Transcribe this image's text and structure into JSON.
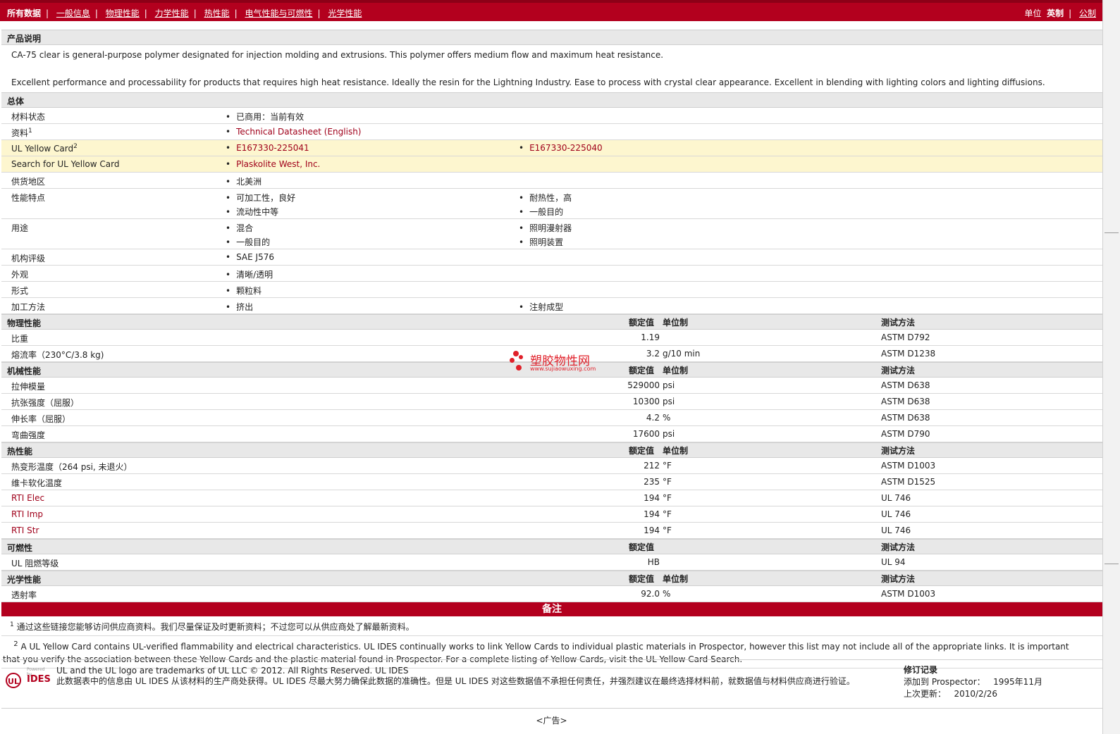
{
  "nav": {
    "all_data": "所有数据",
    "tabs": [
      "一般信息",
      "物理性能",
      "力学性能",
      "热性能",
      "电气性能与可燃性",
      "光学性能"
    ],
    "units_label": "单位",
    "units_english": "英制",
    "units_metric": "公制"
  },
  "description": {
    "title": "产品说明",
    "p1": "CA-75 clear is general-purpose polymer designated for injection molding and extrusions. This polymer offers medium flow and maximum heat resistance.",
    "p2": "Excellent performance and processability for products that requires high heat resistance. Ideally the resin for the Lightning Industry. Ease to process with crystal clear appearance. Excellent in blending with lighting colors and lighting diffusions."
  },
  "general": {
    "title": "总体",
    "rows": [
      {
        "label": "材料状态",
        "sup": "",
        "col1": [
          "已商用：当前有效"
        ],
        "col2": []
      },
      {
        "label": "资料",
        "sup": "1",
        "col1": [
          "Technical Datasheet (English)"
        ],
        "col2": []
      },
      {
        "label": "UL Yellow Card",
        "sup": "2",
        "col1": [
          "E167330-225041"
        ],
        "col2": [
          "E167330-225040"
        ]
      },
      {
        "label": "Search for UL Yellow Card",
        "sup": "",
        "col1": [
          "Plaskolite West, Inc."
        ],
        "col2": []
      },
      {
        "label": "供货地区",
        "sup": "",
        "col1": [
          "北美洲"
        ],
        "col2": []
      },
      {
        "label": "性能特点",
        "sup": "",
        "col1": [
          "可加工性，良好",
          "流动性中等"
        ],
        "col2": [
          "耐热性，高",
          "一般目的"
        ]
      },
      {
        "label": "用途",
        "sup": "",
        "col1": [
          "混合",
          "一般目的"
        ],
        "col2": [
          "照明漫射器",
          "照明装置"
        ]
      },
      {
        "label": "机构评级",
        "sup": "",
        "col1": [
          "SAE J576"
        ],
        "col2": []
      },
      {
        "label": "外观",
        "sup": "",
        "col1": [
          "清晰/透明"
        ],
        "col2": []
      },
      {
        "label": "形式",
        "sup": "",
        "col1": [
          "颗粒料"
        ],
        "col2": []
      },
      {
        "label": "加工方法",
        "sup": "",
        "col1": [
          "挤出"
        ],
        "col2": [
          "注射成型"
        ]
      }
    ]
  },
  "headers": {
    "rated": "额定值",
    "unit": "单位制",
    "method": "测试方法"
  },
  "physical": {
    "title": "物理性能",
    "rows": [
      {
        "label": "比重",
        "value": "1.19",
        "unit": "",
        "method": "ASTM D792"
      },
      {
        "label": "熔流率（230°C/3.8 kg)",
        "value": "3.2",
        "unit": "g/10 min",
        "method": "ASTM D1238"
      }
    ]
  },
  "mechanical": {
    "title": "机械性能",
    "rows": [
      {
        "label": "拉伸模量",
        "value": "529000",
        "unit": "psi",
        "method": "ASTM D638"
      },
      {
        "label": "抗张强度（屈服）",
        "value": "10300",
        "unit": "psi",
        "method": "ASTM D638"
      },
      {
        "label": "伸长率（屈服）",
        "value": "4.2",
        "unit": "%",
        "method": "ASTM D638"
      },
      {
        "label": "弯曲强度",
        "value": "17600",
        "unit": "psi",
        "method": "ASTM D790"
      }
    ]
  },
  "thermal": {
    "title": "热性能",
    "rows": [
      {
        "label": "热变形温度（264 psi, 未退火）",
        "value": "212",
        "unit": "°F",
        "method": "ASTM D1003"
      },
      {
        "label": "维卡软化温度",
        "value": "235",
        "unit": "°F",
        "method": "ASTM D1525"
      },
      {
        "label": "RTI Elec",
        "value": "194",
        "unit": "°F",
        "method": "UL 746"
      },
      {
        "label": "RTI Imp",
        "value": "194",
        "unit": "°F",
        "method": "UL 746"
      },
      {
        "label": "RTI Str",
        "value": "194",
        "unit": "°F",
        "method": "UL 746"
      }
    ]
  },
  "flammability": {
    "title": "可燃性",
    "rows": [
      {
        "label": "UL 阻燃等级",
        "value": "HB",
        "unit": "",
        "method": "UL 94"
      }
    ]
  },
  "optical": {
    "title": "光学性能",
    "rows": [
      {
        "label": "透射率",
        "value": "92.0",
        "unit": "%",
        "method": "ASTM D1003"
      }
    ]
  },
  "notes": {
    "title": "备注",
    "n1_sup": "1",
    "n1": "通过这些链接您能够访问供应商资料。我们尽量保证及时更新资料；不过您可以从供应商处了解最新资料。",
    "n2_sup": "2",
    "n2": "A UL Yellow Card contains UL-verified flammability and electrical characteristics. UL IDES continually works to link Yellow Cards to individual plastic materials in Prospector, however this list may not include all of the appropriate links. It is important that you verify the association between these Yellow Cards and the plastic material found in Prospector. For a complete listing of Yellow Cards, visit the UL Yellow Card Search."
  },
  "footer": {
    "logo_powered": "Powered by",
    "logo_ul": "UL",
    "logo_ides": "IDES",
    "legal1": "UL and the UL logo are trademarks of UL LLC © 2012. All Rights Reserved. UL IDES",
    "legal2": "此数据表中的信息由 UL IDES 从该材料的生产商处获得。UL IDES 尽最大努力确保此数据的准确性。但是 UL IDES 对这些数据值不承担任何责任，并强烈建议在最终选择材料前，就数据值与材料供应商进行验证。",
    "rev_title": "修订记录",
    "added_label": "添加到 Prospector：",
    "added_value": "1995年11月",
    "updated_label": "上次更新：",
    "updated_value": "2010/2/26",
    "ad": "<广告>"
  },
  "watermark": {
    "text": "塑胶物性网",
    "url": "www.sujiaowuxing.com",
    "color": "#e0202a"
  },
  "colors": {
    "brand_red": "#b3001e",
    "highlight": "#fdf6cf",
    "section_bg": "#e8e8e8"
  }
}
